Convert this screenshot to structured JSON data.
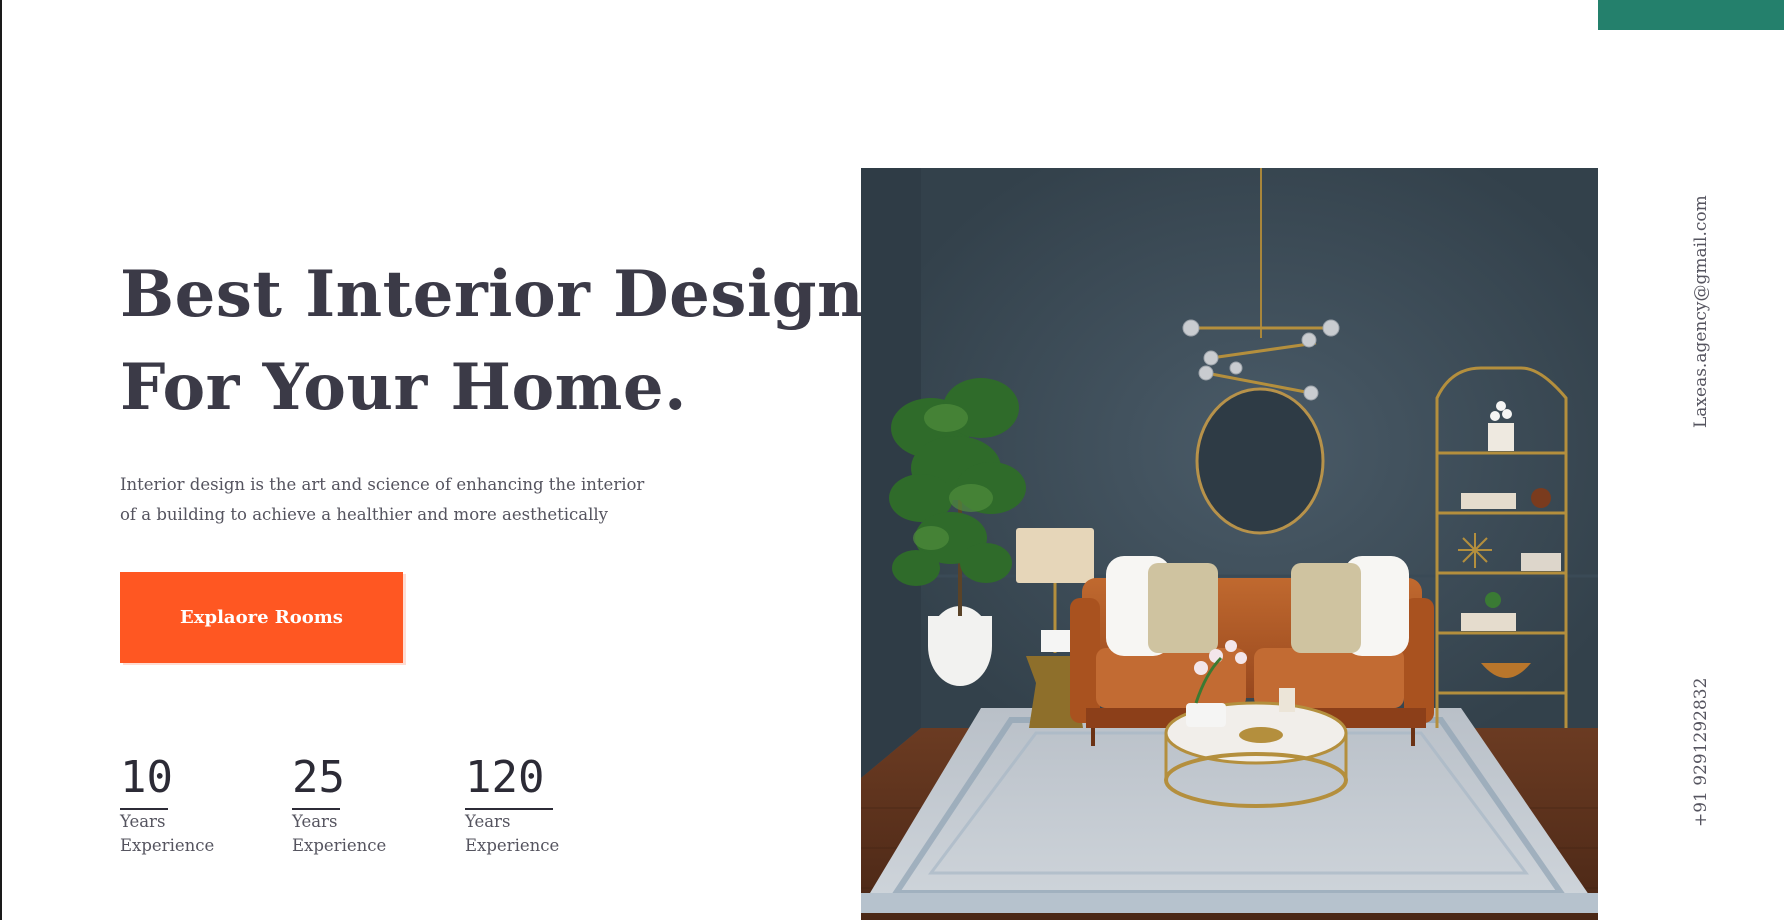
{
  "colors": {
    "accent_teal": "#24806c",
    "cta_orange": "#ff5722",
    "heading": "#3b3a47",
    "body_text": "#55545f"
  },
  "hero": {
    "title_line1": "Best Interior Design",
    "title_line2": "For Your Home.",
    "description_line1": "Interior design is the art and science of enhancing the interior",
    "description_line2": "of a building to achieve a healthier and more aesthetically",
    "cta_label": "Explaore Rooms"
  },
  "stats": [
    {
      "value": "10",
      "label_line1": "Years",
      "label_line2": "Experience"
    },
    {
      "value": "25",
      "label_line1": "Years",
      "label_line2": "Experience"
    },
    {
      "value": "120",
      "label_line1": "Years",
      "label_line2": "Experience"
    }
  ],
  "contact": {
    "email": "Laxeas.agency@gmail.com",
    "phone": "+91 9291292832"
  },
  "hero_image": {
    "icon": "living-room-image"
  }
}
